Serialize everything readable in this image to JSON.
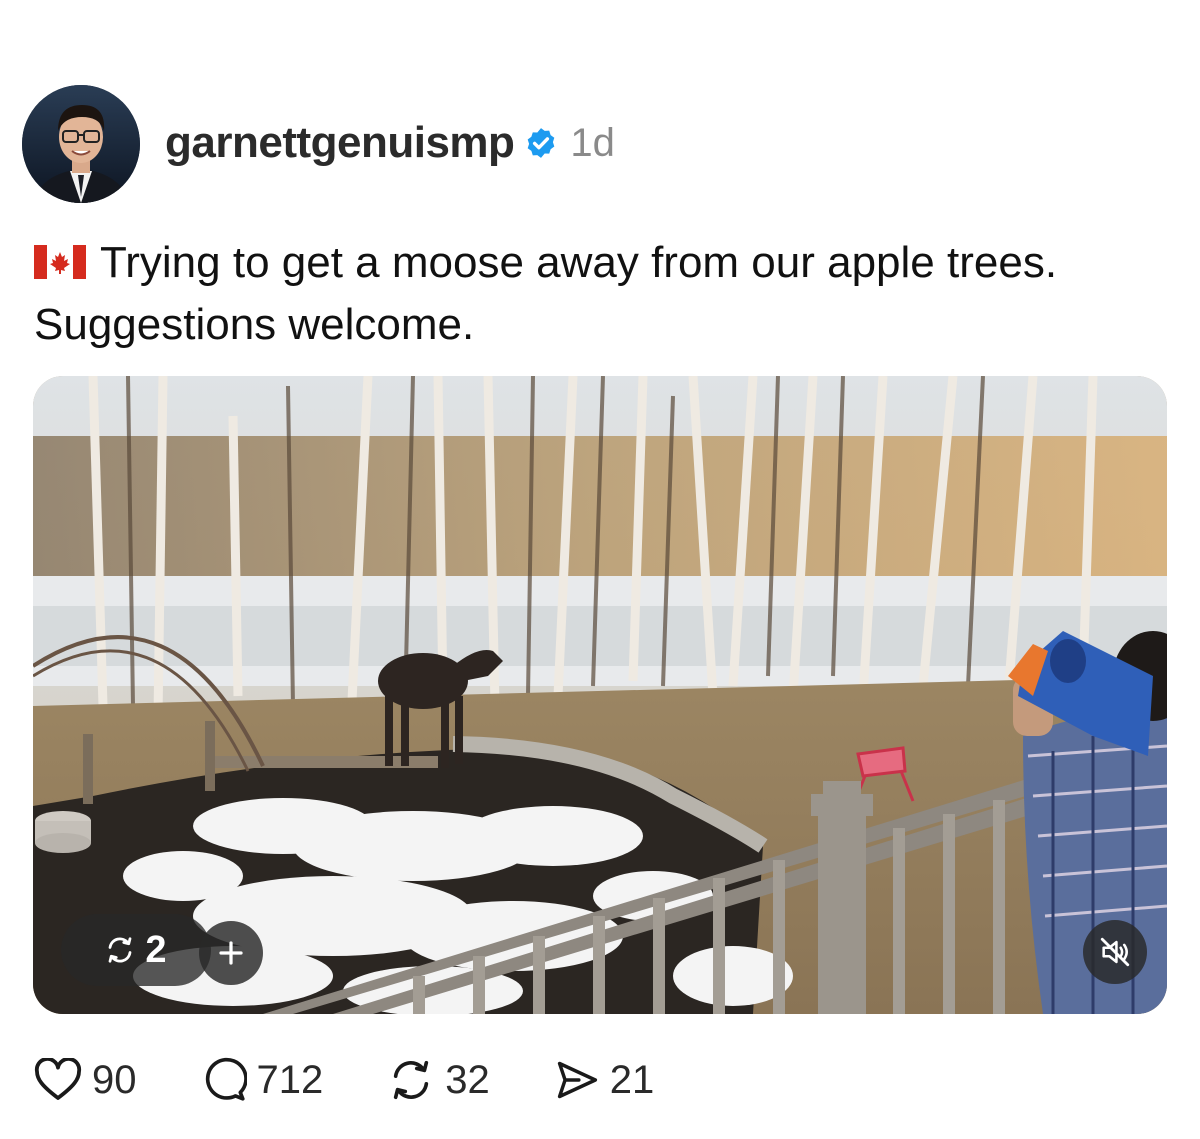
{
  "post": {
    "username": "garnettgenuismp",
    "verified": true,
    "timestamp": "1d",
    "caption_flag": "canada-flag",
    "caption": "Trying to get a moose away from our apple trees. Suggestions welcome."
  },
  "media": {
    "repost_count": "2",
    "plus_icon": "plus-icon",
    "mute_icon": "speaker-muted-icon"
  },
  "actions": {
    "likes": "90",
    "comments": "712",
    "reposts": "32",
    "shares": "21"
  },
  "colors": {
    "verified_blue": "#1d9bf0",
    "text": "#111111",
    "muted": "#8a8a8a"
  }
}
